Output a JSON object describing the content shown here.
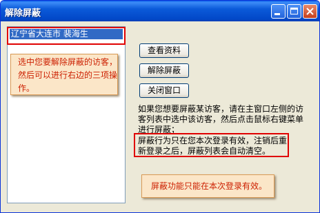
{
  "window": {
    "title": "解除屏蔽"
  },
  "list": {
    "items": [
      "辽宁省大连市 裴海生"
    ]
  },
  "buttons": {
    "view_profile": "查看资料",
    "unblock": "解除屏蔽",
    "close_window": "关闭窗口"
  },
  "info": {
    "text": "如果您想要屏蔽某访客，请在主窗口左侧的访客列表中选中该访客，然后点击鼠标右键菜单进行屏蔽；",
    "scope_note": "屏蔽行为只在您本次登录有效，注销后重新登录之后，屏蔽列表会自动清空。"
  },
  "annotations": {
    "list_callout": "选中您要解除屏蔽的访客，然后可以进行右边的三项操作。",
    "bottom_callout": "屏蔽功能只能在本次登录有效。"
  },
  "colors": {
    "titlebar": "#0b5ad9",
    "selection": "#316ac5",
    "highlight_frame": "#e00000",
    "callout_bg": "#fbe6c8",
    "callout_text": "#cc1f00"
  },
  "icons": {
    "minimize": "minimize-icon",
    "maximize": "maximize-icon",
    "close": "close-icon"
  }
}
